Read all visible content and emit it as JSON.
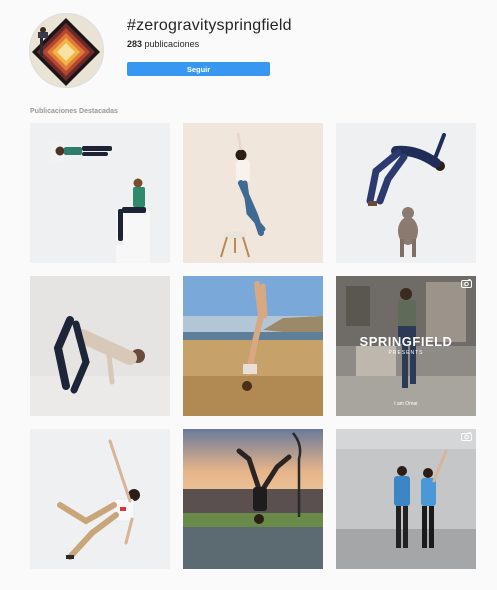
{
  "hashtag": {
    "title": "#zerogravityspringfield",
    "post_count": "283",
    "post_count_label": "publicaciones",
    "follow_label": "Seguir"
  },
  "section": {
    "title": "Publicaciones Destacadas"
  },
  "posts": [
    {
      "index": 1,
      "scene": "person lying horizontally and person sitting on white block"
    },
    {
      "index": 2,
      "scene": "woman stretched on floor next to wooden stool"
    },
    {
      "index": 3,
      "scene": "man upside down over grey dog"
    },
    {
      "index": 4,
      "scene": "man posing on floor, grey wall"
    },
    {
      "index": 5,
      "scene": "handstand on beach"
    },
    {
      "index": 6,
      "scene": "man standing in front of building with logo overlay",
      "overlay_brand": "SPRINGFIELD",
      "overlay_sub": "PRESENTS",
      "overlay_caption": "I am Omar",
      "type_icon": "video-icon"
    },
    {
      "index": 7,
      "scene": "man in white t-shirt posing on white floor"
    },
    {
      "index": 8,
      "scene": "handstand at sunset near lamp post"
    },
    {
      "index": 9,
      "scene": "couple dancing in the street",
      "type_icon": "video-icon"
    }
  ],
  "colors": {
    "accent": "#3897f0",
    "background": "#fafafa",
    "muted_text": "#999999"
  }
}
